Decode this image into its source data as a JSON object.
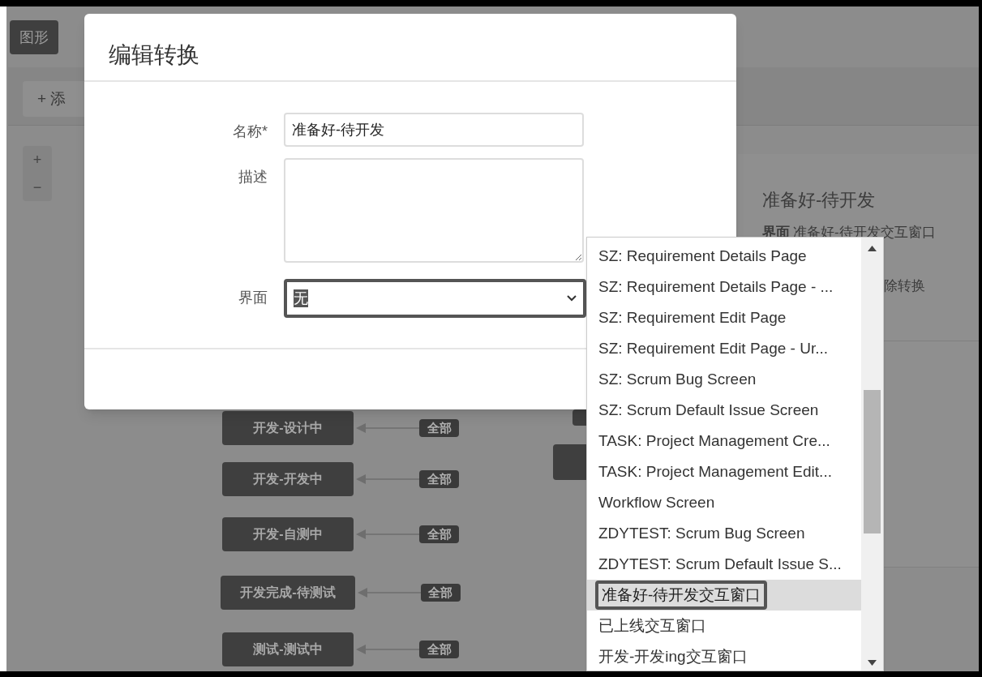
{
  "tabs": [
    {
      "label": "图形",
      "selected": true
    }
  ],
  "toolbar": {
    "add_button": "+ 添"
  },
  "zoom_controls": [
    "+",
    "−"
  ],
  "diagram": {
    "nodes": [
      {
        "label": "开发-设计中",
        "badge": "全部"
      },
      {
        "label": "开发-开发中",
        "badge": "全部"
      },
      {
        "label": "开发-自测中",
        "badge": "全部"
      },
      {
        "label": "开发完成-待测试",
        "badge": "全部"
      },
      {
        "label": "测试-测试中",
        "badge": "全部"
      }
    ]
  },
  "details_panel": {
    "title": "准备好-待开发",
    "screen_label": "界面",
    "screen_value": "准备好-待开发交互窗口",
    "action": "除转换"
  },
  "dialog": {
    "title": "编辑转换",
    "fields": [
      {
        "label": "名称*",
        "kind": "text",
        "value": "准备好-待开发"
      },
      {
        "label": "描述",
        "kind": "textarea"
      },
      {
        "label": "界面",
        "kind": "select",
        "value": "无",
        "focused": true
      }
    ]
  },
  "dropdown": {
    "options": [
      {
        "label": "SZ: Requirement Details Page",
        "selected": false
      },
      {
        "label": "SZ: Requirement Details Page - ...",
        "selected": false
      },
      {
        "label": "SZ: Requirement Edit Page",
        "selected": false
      },
      {
        "label": "SZ: Requirement Edit Page - Ur...",
        "selected": false
      },
      {
        "label": "SZ: Scrum Bug Screen",
        "selected": false
      },
      {
        "label": "SZ: Scrum Default Issue Screen",
        "selected": false
      },
      {
        "label": "TASK: Project Management Cre...",
        "selected": false
      },
      {
        "label": "TASK: Project Management Edit...",
        "selected": false
      },
      {
        "label": "Workflow Screen",
        "selected": false
      },
      {
        "label": "ZDYTEST: Scrum Bug Screen",
        "selected": false
      },
      {
        "label": "ZDYTEST: Scrum Default Issue S...",
        "selected": false
      },
      {
        "label": "准备好-待开发交互窗口",
        "selected": true
      },
      {
        "label": "已上线交互窗口",
        "selected": false
      },
      {
        "label": "开发-开发ing交互窗口",
        "selected": false
      }
    ]
  }
}
